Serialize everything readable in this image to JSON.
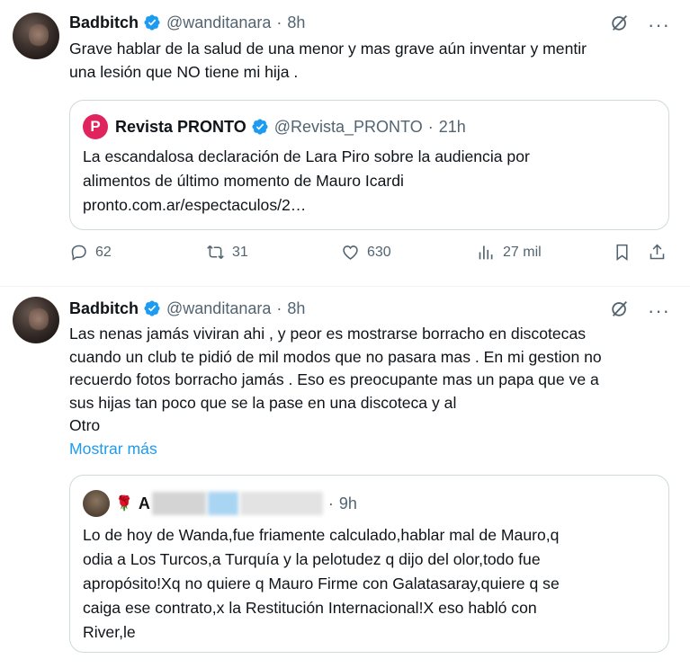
{
  "tweet1": {
    "name": "Badbitch",
    "handle": "@wanditanara",
    "dot": "·",
    "time": "8h",
    "more": "···",
    "lines": [
      "Grave hablar de la salud de una menor y mas grave aún inventar y mentir",
      "una lesión que NO tiene mi hija ."
    ],
    "quote": {
      "avatar_letter": "P",
      "name": "Revista PRONTO",
      "handle": "@Revista_PRONTO",
      "dot": "·",
      "time": "21h",
      "lines": [
        "La escandalosa declaración de Lara Piro sobre la audiencia por",
        "alimentos de último momento de Mauro Icardi",
        "pronto.com.ar/espectaculos/2…"
      ]
    },
    "actions": {
      "replies": "62",
      "reposts": "31",
      "likes": "630",
      "views": "27 mil"
    }
  },
  "tweet2": {
    "name": "Badbitch",
    "handle": "@wanditanara",
    "dot": "·",
    "time": "8h",
    "more": "···",
    "lines": [
      "Las nenas jamás viviran ahi , y peor es mostrarse borracho en discotecas",
      "cuando un club te pidió de mil modos que no pasara mas . En mi gestion no",
      "recuerdo fotos borracho jamás . Eso es preocupante mas un papa que ve a",
      "sus hijas tan poco que se la pase en una discoteca y al",
      "Otro"
    ],
    "show_more": "Mostrar más",
    "quote": {
      "name": "A",
      "dot": "·",
      "time": "9h",
      "lines": [
        "Lo de hoy de Wanda,fue friamente calculado,hablar mal de Mauro,q",
        "odia a Los Turcos,a Turquía  y la pelotudez q dijo del olor,todo fue",
        "apropósito!Xq no quiere q Mauro Firme con Galatasaray,quiere q se",
        "caiga ese contrato,x la Restitución Internacional!X eso habló con",
        "River,le"
      ]
    }
  },
  "colors": {
    "accent": "#1d9bf0",
    "secondary_text": "#536471",
    "verified_blue": "#1d9bf0",
    "pronto_red": "#e0245e"
  },
  "icons": [
    "verified-badge-icon",
    "grok-icon",
    "more-icon",
    "reply-icon",
    "repost-icon",
    "like-icon",
    "views-icon",
    "bookmark-icon",
    "share-icon",
    "rose-icon"
  ]
}
